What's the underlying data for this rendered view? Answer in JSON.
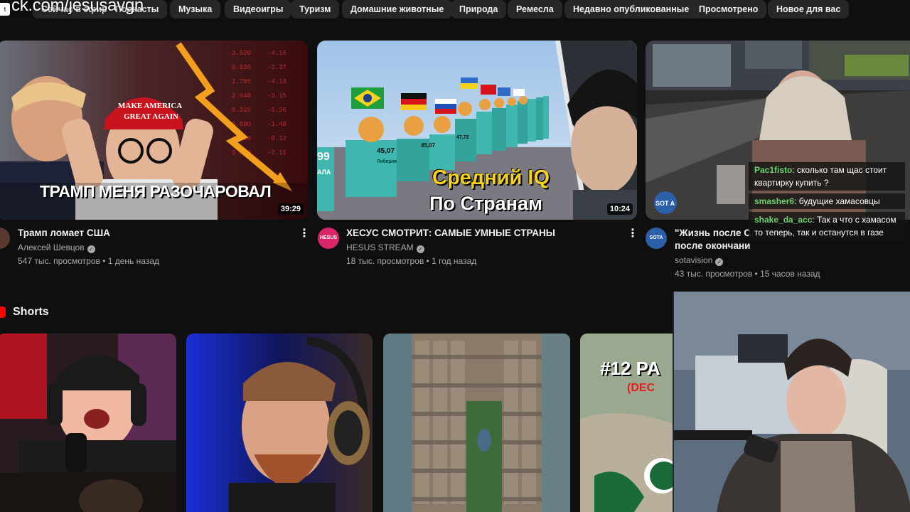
{
  "overlay": {
    "url_text": "ck.com/jesusavgn",
    "box_icon": "t"
  },
  "chips": [
    {
      "label": "Сейчас в эфире"
    },
    {
      "label": "Подкасты"
    },
    {
      "label": "Музыка"
    },
    {
      "label": "Видеоигры"
    },
    {
      "label": "Туризм"
    },
    {
      "label": "Домашние животные"
    },
    {
      "label": "Природа"
    },
    {
      "label": "Ремесла"
    },
    {
      "label": "Недавно опубликованные"
    },
    {
      "label": "Просмотрено"
    },
    {
      "label": "Новое для вас"
    }
  ],
  "videos": [
    {
      "title": "Трамп ломает США",
      "channel": "Алексей Шевцов",
      "stats": "547 тыс. просмотров • 1 день назад",
      "duration": "39:29",
      "thumb_text": "ТРАМП МЕНЯ РАЗОЧАРОВАЛ",
      "cap_text": "MAKE AMERICA GREAT AGAIN"
    },
    {
      "title": "ХЕСУС СМОТРИТ: САМЫЕ УМНЫЕ СТРАНЫ",
      "channel": "HESUS STREAM",
      "avatar_text": "HESUS",
      "stats": "18 тыс. просмотров • 1 год назад",
      "duration": "10:24",
      "thumb_line1": "Средний IQ",
      "thumb_line2": "По Странам",
      "bar_labels": [
        "45,07",
        "Либерия",
        "47,72"
      ],
      "left_value": "99"
    },
    {
      "title_line1": "\"Жизнь после С",
      "title_line2": "после окончани",
      "channel": "sotavision",
      "avatar_text": "SOTA",
      "stats": "43 тыс. просмотров • 15 часов назад",
      "thumb_logo": "SOT A"
    }
  ],
  "shorts": {
    "title": "Shorts",
    "items": [
      {
        "kind": "streamer-headphones"
      },
      {
        "kind": "bearded-man"
      },
      {
        "kind": "city-aerial"
      },
      {
        "kind": "map",
        "text": "#12 PA",
        "sub": "(DEC"
      }
    ]
  },
  "chat": [
    {
      "user": "Pac1fisto",
      "text": "сколько там щас стоит квартирку купить ?"
    },
    {
      "user": "smasher6",
      "text": "будущие хамасовцы"
    },
    {
      "user": "shake_da_acc",
      "text": "Так а что с хамасом то теперь, так и останутся в газе"
    }
  ],
  "colors": {
    "background": "#0f0f0f",
    "chip": "#272727",
    "text_secondary": "#aaaaaa",
    "chat_user": "#6dd36d",
    "shorts_red": "#ff0000"
  }
}
